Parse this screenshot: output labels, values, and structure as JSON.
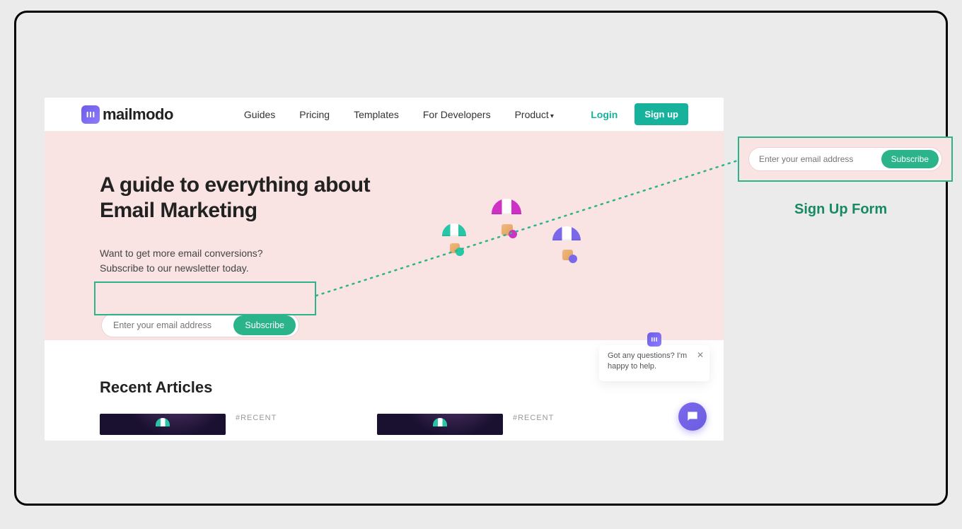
{
  "brand": {
    "name": "mailmodo"
  },
  "nav": {
    "items": [
      "Guides",
      "Pricing",
      "Templates",
      "For Developers",
      "Product"
    ],
    "login": "Login",
    "signup": "Sign up"
  },
  "hero": {
    "title": "A guide to everything about Email Marketing",
    "sub_line1": "Want to get more email conversions?",
    "sub_line2": "Subscribe to our newsletter today."
  },
  "subscribe": {
    "placeholder": "Enter your email address",
    "button": "Subscribe"
  },
  "callout": {
    "label": "Sign Up Form"
  },
  "recent": {
    "heading": "Recent Articles",
    "tag": "#RECENT"
  },
  "chat": {
    "prompt": "Got any questions? I'm happy to help."
  }
}
